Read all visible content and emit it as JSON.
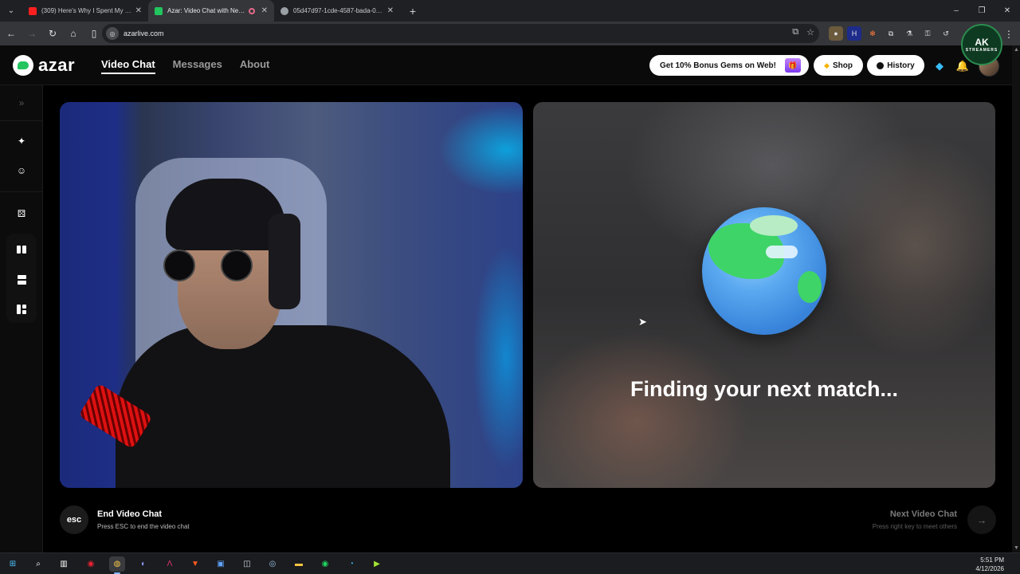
{
  "browser": {
    "tabs": [
      {
        "title": "(309) Here's Why I Spent My Co...",
        "favicon_color": "#ff1f1f",
        "active": false
      },
      {
        "title": "Azar: Video Chat with New ...",
        "favicon_color": "#22c55e",
        "active": true
      },
      {
        "title": "05d47d97-1cde-4587-bada-0c8...",
        "favicon_color": "#9aa0a6",
        "active": false
      }
    ],
    "new_tab_symbol": "+",
    "url": "azarlive.com",
    "window_controls": [
      "–",
      "❐",
      "✕"
    ]
  },
  "extensions": {
    "ak_logo_text": "AK",
    "ak_logo_sub": "STREAMERS"
  },
  "app": {
    "brand": "azar",
    "nav": [
      {
        "label": "Video Chat",
        "active": true
      },
      {
        "label": "Messages",
        "active": false
      },
      {
        "label": "About",
        "active": false
      }
    ],
    "promo_label": "Get 10% Bonus Gems on Web!",
    "shop_label": "Shop",
    "history_label": "History"
  },
  "rail": {
    "icons": [
      "expand-icon",
      "magic-wand-icon",
      "smiley-icon",
      "dice-icon",
      "layout-split-vertical-icon",
      "layout-split-horizontal-icon",
      "layout-grid-icon"
    ]
  },
  "main": {
    "finding_text": "Finding your next match...",
    "end_key": "esc",
    "end_title": "End Video Chat",
    "end_sub": "Press ESC to end the video chat",
    "next_title": "Next Video Chat",
    "next_sub": "Press right key to meet others",
    "next_arrow": "→"
  },
  "taskbar": {
    "time": "5:51 PM",
    "date": "4/12/2026"
  },
  "colors": {
    "accent_green": "#22c55e",
    "background": "#000000",
    "gem_gold": "#f5b301",
    "gem_blue": "#38bdf8"
  }
}
